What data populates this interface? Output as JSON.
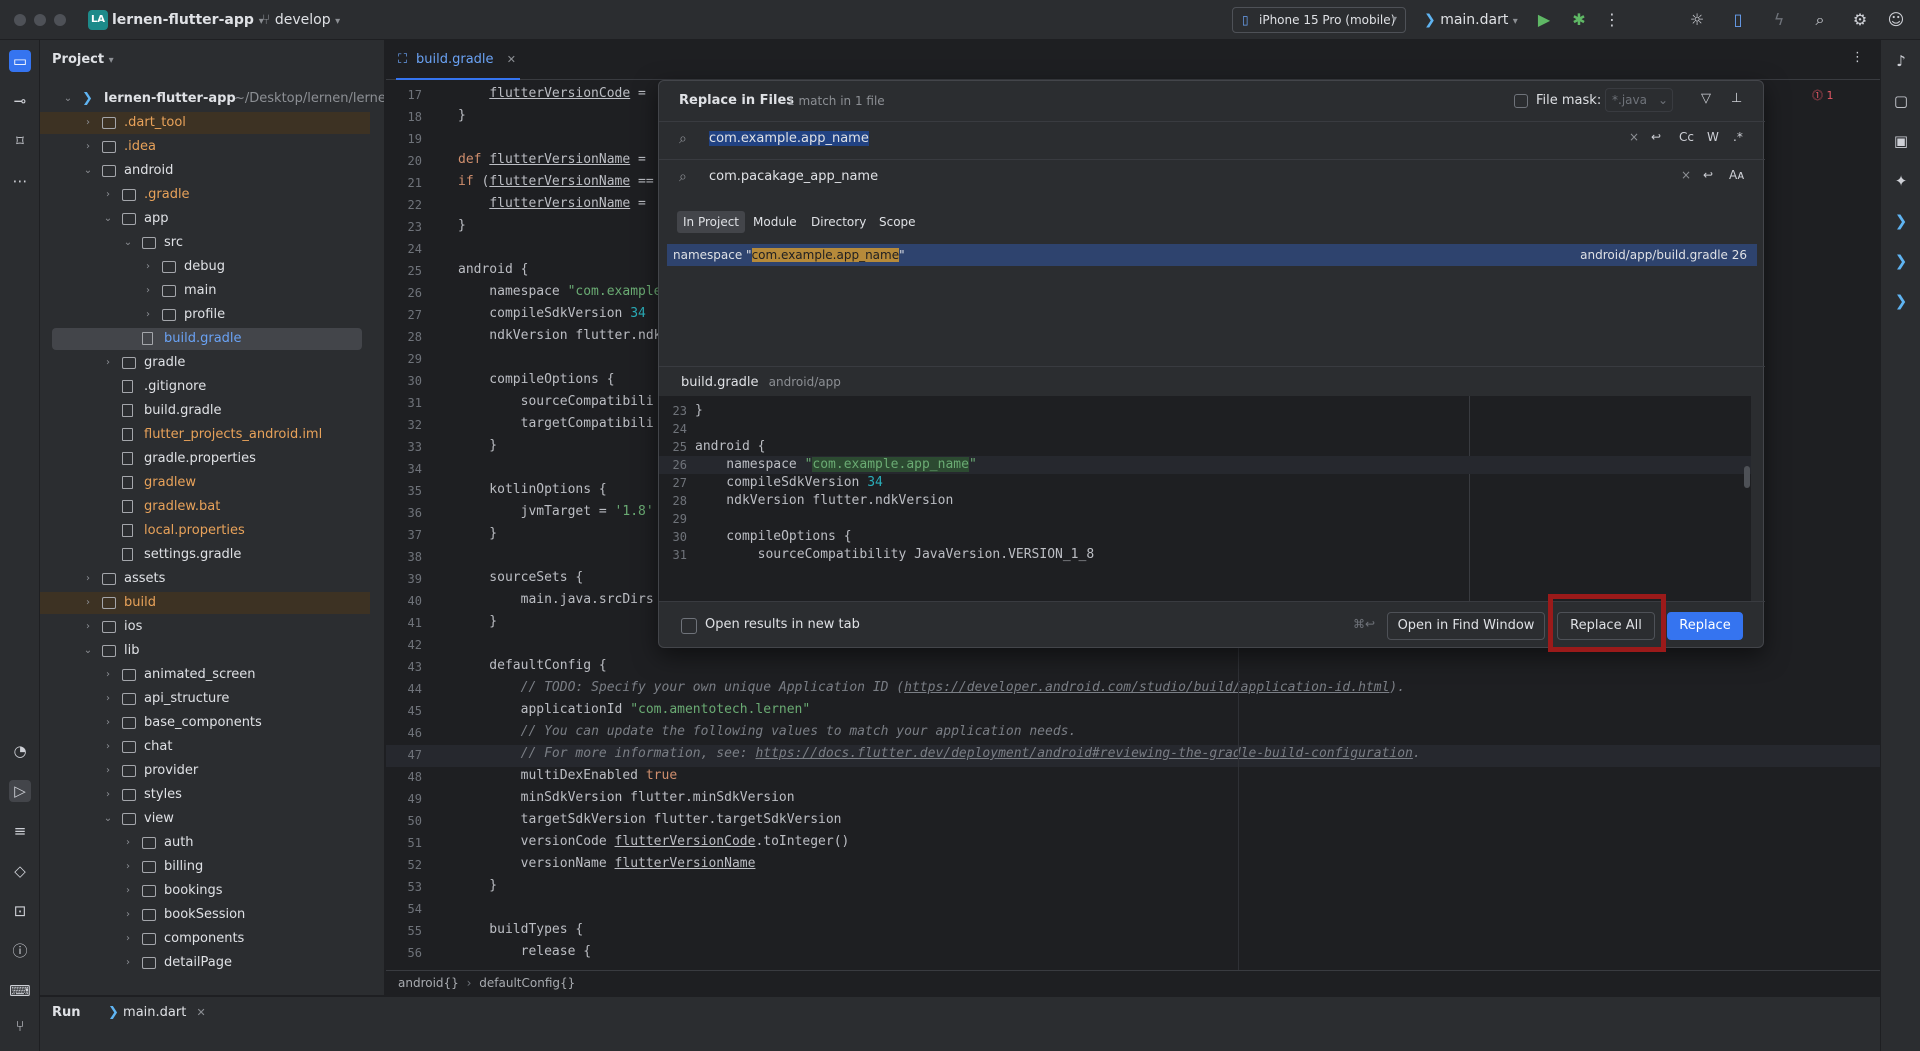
{
  "topbar": {
    "project_badge": "LA",
    "project_name": "lernen-flutter-app",
    "branch": "develop",
    "device": "iPhone 15 Pro (mobile)",
    "run_config": "main.dart"
  },
  "project_panel": {
    "title": "Project",
    "items": [
      {
        "label": "lernen-flutter-app",
        "path": "~/Desktop/lernen/lernen-f",
        "depth": 0,
        "chev": "open",
        "type": "root"
      },
      {
        "label": ".dart_tool",
        "depth": 1,
        "chev": "closed",
        "type": "folder",
        "color": "orange",
        "hl": true
      },
      {
        "label": ".idea",
        "depth": 1,
        "chev": "closed",
        "type": "folder",
        "color": "orange"
      },
      {
        "label": "android",
        "depth": 1,
        "chev": "open",
        "type": "folder"
      },
      {
        "label": ".gradle",
        "depth": 2,
        "chev": "closed",
        "type": "folder",
        "color": "orange"
      },
      {
        "label": "app",
        "depth": 2,
        "chev": "open",
        "type": "folder"
      },
      {
        "label": "src",
        "depth": 3,
        "chev": "open",
        "type": "folder"
      },
      {
        "label": "debug",
        "depth": 4,
        "chev": "closed",
        "type": "folder"
      },
      {
        "label": "main",
        "depth": 4,
        "chev": "closed",
        "type": "folder"
      },
      {
        "label": "profile",
        "depth": 4,
        "chev": "closed",
        "type": "folder"
      },
      {
        "label": "build.gradle",
        "depth": 3,
        "chev": "none",
        "type": "file",
        "color": "blue",
        "sel": true
      },
      {
        "label": "gradle",
        "depth": 2,
        "chev": "closed",
        "type": "folder"
      },
      {
        "label": ".gitignore",
        "depth": 2,
        "chev": "none",
        "type": "file"
      },
      {
        "label": "build.gradle",
        "depth": 2,
        "chev": "none",
        "type": "file"
      },
      {
        "label": "flutter_projects_android.iml",
        "depth": 2,
        "chev": "none",
        "type": "file",
        "color": "orange"
      },
      {
        "label": "gradle.properties",
        "depth": 2,
        "chev": "none",
        "type": "file"
      },
      {
        "label": "gradlew",
        "depth": 2,
        "chev": "none",
        "type": "file",
        "color": "orange"
      },
      {
        "label": "gradlew.bat",
        "depth": 2,
        "chev": "none",
        "type": "file",
        "color": "orange"
      },
      {
        "label": "local.properties",
        "depth": 2,
        "chev": "none",
        "type": "file",
        "color": "orange"
      },
      {
        "label": "settings.gradle",
        "depth": 2,
        "chev": "none",
        "type": "file"
      },
      {
        "label": "assets",
        "depth": 1,
        "chev": "closed",
        "type": "folder"
      },
      {
        "label": "build",
        "depth": 1,
        "chev": "closed",
        "type": "folder",
        "color": "orange",
        "hl": true
      },
      {
        "label": "ios",
        "depth": 1,
        "chev": "closed",
        "type": "folder"
      },
      {
        "label": "lib",
        "depth": 1,
        "chev": "open",
        "type": "folder"
      },
      {
        "label": "animated_screen",
        "depth": 2,
        "chev": "closed",
        "type": "folder"
      },
      {
        "label": "api_structure",
        "depth": 2,
        "chev": "closed",
        "type": "folder"
      },
      {
        "label": "base_components",
        "depth": 2,
        "chev": "closed",
        "type": "folder"
      },
      {
        "label": "chat",
        "depth": 2,
        "chev": "closed",
        "type": "folder"
      },
      {
        "label": "provider",
        "depth": 2,
        "chev": "closed",
        "type": "folder"
      },
      {
        "label": "styles",
        "depth": 2,
        "chev": "closed",
        "type": "folder"
      },
      {
        "label": "view",
        "depth": 2,
        "chev": "open",
        "type": "folder"
      },
      {
        "label": "auth",
        "depth": 3,
        "chev": "closed",
        "type": "folder"
      },
      {
        "label": "billing",
        "depth": 3,
        "chev": "closed",
        "type": "folder"
      },
      {
        "label": "bookings",
        "depth": 3,
        "chev": "closed",
        "type": "folder"
      },
      {
        "label": "bookSession",
        "depth": 3,
        "chev": "closed",
        "type": "folder"
      },
      {
        "label": "components",
        "depth": 3,
        "chev": "closed",
        "type": "folder"
      },
      {
        "label": "detailPage",
        "depth": 3,
        "chev": "closed",
        "type": "folder"
      }
    ]
  },
  "editor": {
    "tab_label": "build.gradle",
    "lines": [
      {
        "n": "17",
        "html": "    <span class='und'>flutterVersionCode</span> ="
      },
      {
        "n": "18",
        "html": "}"
      },
      {
        "n": "19",
        "html": ""
      },
      {
        "n": "20",
        "html": "<span class='kw'>def</span> <span class='und'>flutterVersionName</span> ="
      },
      {
        "n": "21",
        "html": "<span class='kw'>if</span> (<span class='und'>flutterVersionName</span> =="
      },
      {
        "n": "22",
        "html": "    <span class='und'>flutterVersionName</span> ="
      },
      {
        "n": "23",
        "html": "}"
      },
      {
        "n": "24",
        "html": ""
      },
      {
        "n": "25",
        "html": "android {"
      },
      {
        "n": "26",
        "html": "    namespace <span class='str'>\"com.example</span>"
      },
      {
        "n": "27",
        "html": "    compileSdkVersion <span class='num'>34</span>"
      },
      {
        "n": "28",
        "html": "    ndkVersion flutter.ndk"
      },
      {
        "n": "29",
        "html": ""
      },
      {
        "n": "30",
        "html": "    compileOptions {"
      },
      {
        "n": "31",
        "html": "        sourceCompatibili"
      },
      {
        "n": "32",
        "html": "        targetCompatibili"
      },
      {
        "n": "33",
        "html": "    }"
      },
      {
        "n": "34",
        "html": ""
      },
      {
        "n": "35",
        "html": "    kotlinOptions {"
      },
      {
        "n": "36",
        "html": "        jvmTarget = <span class='str'>'1.8'</span>"
      },
      {
        "n": "37",
        "html": "    }"
      },
      {
        "n": "38",
        "html": ""
      },
      {
        "n": "39",
        "html": "    sourceSets {"
      },
      {
        "n": "40",
        "html": "        main.java.srcDirs"
      },
      {
        "n": "41",
        "html": "    }"
      },
      {
        "n": "42",
        "html": ""
      },
      {
        "n": "43",
        "html": "    defaultConfig {"
      },
      {
        "n": "44",
        "html": "        <span class='cmt'>// TODO: Specify your own unique Application ID (</span><span class='link'>https://developer.android.com/studio/build/application-id.html</span><span class='cmt'>).</span>"
      },
      {
        "n": "45",
        "html": "        applicationId <span class='str'>\"com.amentotech.lernen\"</span>"
      },
      {
        "n": "46",
        "html": "        <span class='cmt'>// You can update the following values to match your application needs.</span>"
      },
      {
        "n": "47",
        "html": "        <span class='cmt'>// For more information, see: </span><span class='link'>https://docs.flutter.dev/deployment/android#reviewing-the-gradle-build-configuration</span><span class='cmt'>.</span>"
      },
      {
        "n": "48",
        "html": "        multiDexEnabled <span class='kw'>true</span>"
      },
      {
        "n": "49",
        "html": "        minSdkVersion flutter.minSdkVersion"
      },
      {
        "n": "50",
        "html": "        targetSdkVersion flutter.targetSdkVersion"
      },
      {
        "n": "51",
        "html": "        versionCode <span class='und'>flutterVersionCode</span>.toInteger()"
      },
      {
        "n": "52",
        "html": "        versionName <span class='und'>flutterVersionName</span>"
      },
      {
        "n": "53",
        "html": "    }"
      },
      {
        "n": "54",
        "html": ""
      },
      {
        "n": "55",
        "html": "    buildTypes {"
      },
      {
        "n": "56",
        "html": "        release {"
      }
    ],
    "breadcrumb_1": "android{}",
    "breadcrumb_2": "defaultConfig{}",
    "error_count": "1"
  },
  "dialog": {
    "title": "Replace in Files",
    "subtitle": "1 match in 1 file",
    "file_mask_label": "File mask:",
    "file_mask_placeholder": "*.java",
    "search_value": "com.example.app_name",
    "replace_value": "com.pacakage_app_name",
    "opt_case": "Cc",
    "opt_word": "W",
    "opt_regex": ".*",
    "scopes": [
      "In Project",
      "Module",
      "Directory",
      "Scope"
    ],
    "result_prefix": "namespace \"",
    "result_match": "com.example.app_name",
    "result_suffix": "\"",
    "result_location": "android/app/build.gradle 26",
    "preview_file": "build.gradle",
    "preview_path": "android/app",
    "preview_lines": [
      {
        "n": "23",
        "html": "}"
      },
      {
        "n": "24",
        "html": ""
      },
      {
        "n": "25",
        "html": "android {"
      },
      {
        "n": "26",
        "html": "    namespace <span class='str'>\"</span><span class='str-hl'>com.example.app_name</span><span class='str'>\"</span>"
      },
      {
        "n": "27",
        "html": "    compileSdkVersion <span class='num'>34</span>"
      },
      {
        "n": "28",
        "html": "    ndkVersion flutter.ndkVersion"
      },
      {
        "n": "29",
        "html": ""
      },
      {
        "n": "30",
        "html": "    compileOptions {"
      },
      {
        "n": "31",
        "html": "        sourceCompatibility JavaVersion.VERSION_1_8"
      }
    ],
    "open_new_tab": "Open results in new tab",
    "shortcut": "⌘↩",
    "btn_find_window": "Open in Find Window",
    "btn_replace_all": "Replace All",
    "btn_replace": "Replace"
  },
  "run_panel": {
    "run_label": "Run",
    "tab_label": "main.dart"
  }
}
